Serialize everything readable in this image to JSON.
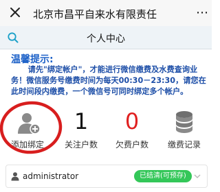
{
  "appbar": {
    "title": "北京市昌平自来水有限责任",
    "more_label": "⋯"
  },
  "header": {
    "title": "个人中心"
  },
  "notice": {
    "title": "温馨提示:",
    "text": "请先\"绑定帐户\"，才能进行微信缴费及水费查询业务！微信服务号缴费时间为每天00:30－23:30，请您在此时间段内缴费，一个微信号可同时绑定多个帐户。"
  },
  "stats": {
    "add_label": "添加绑定",
    "followers_value": "1",
    "followers_label": "关注户数",
    "arrears_value": "0",
    "arrears_label": "欠费户数",
    "records_label": "缴费记录"
  },
  "account": {
    "name": "administrator",
    "status": "已结清(可预存)"
  },
  "colors": {
    "accent_blue": "#1e62c8",
    "arrears_red": "#e02020",
    "status_green": "#34c759",
    "highlight_circle": "#d81e1e"
  },
  "icons": {
    "close": "close-icon",
    "search": "search-icon",
    "add_user": "add-user-icon",
    "records": "coin-stack-icon",
    "person": "person-icon",
    "chevron": "chevron-down-icon"
  }
}
